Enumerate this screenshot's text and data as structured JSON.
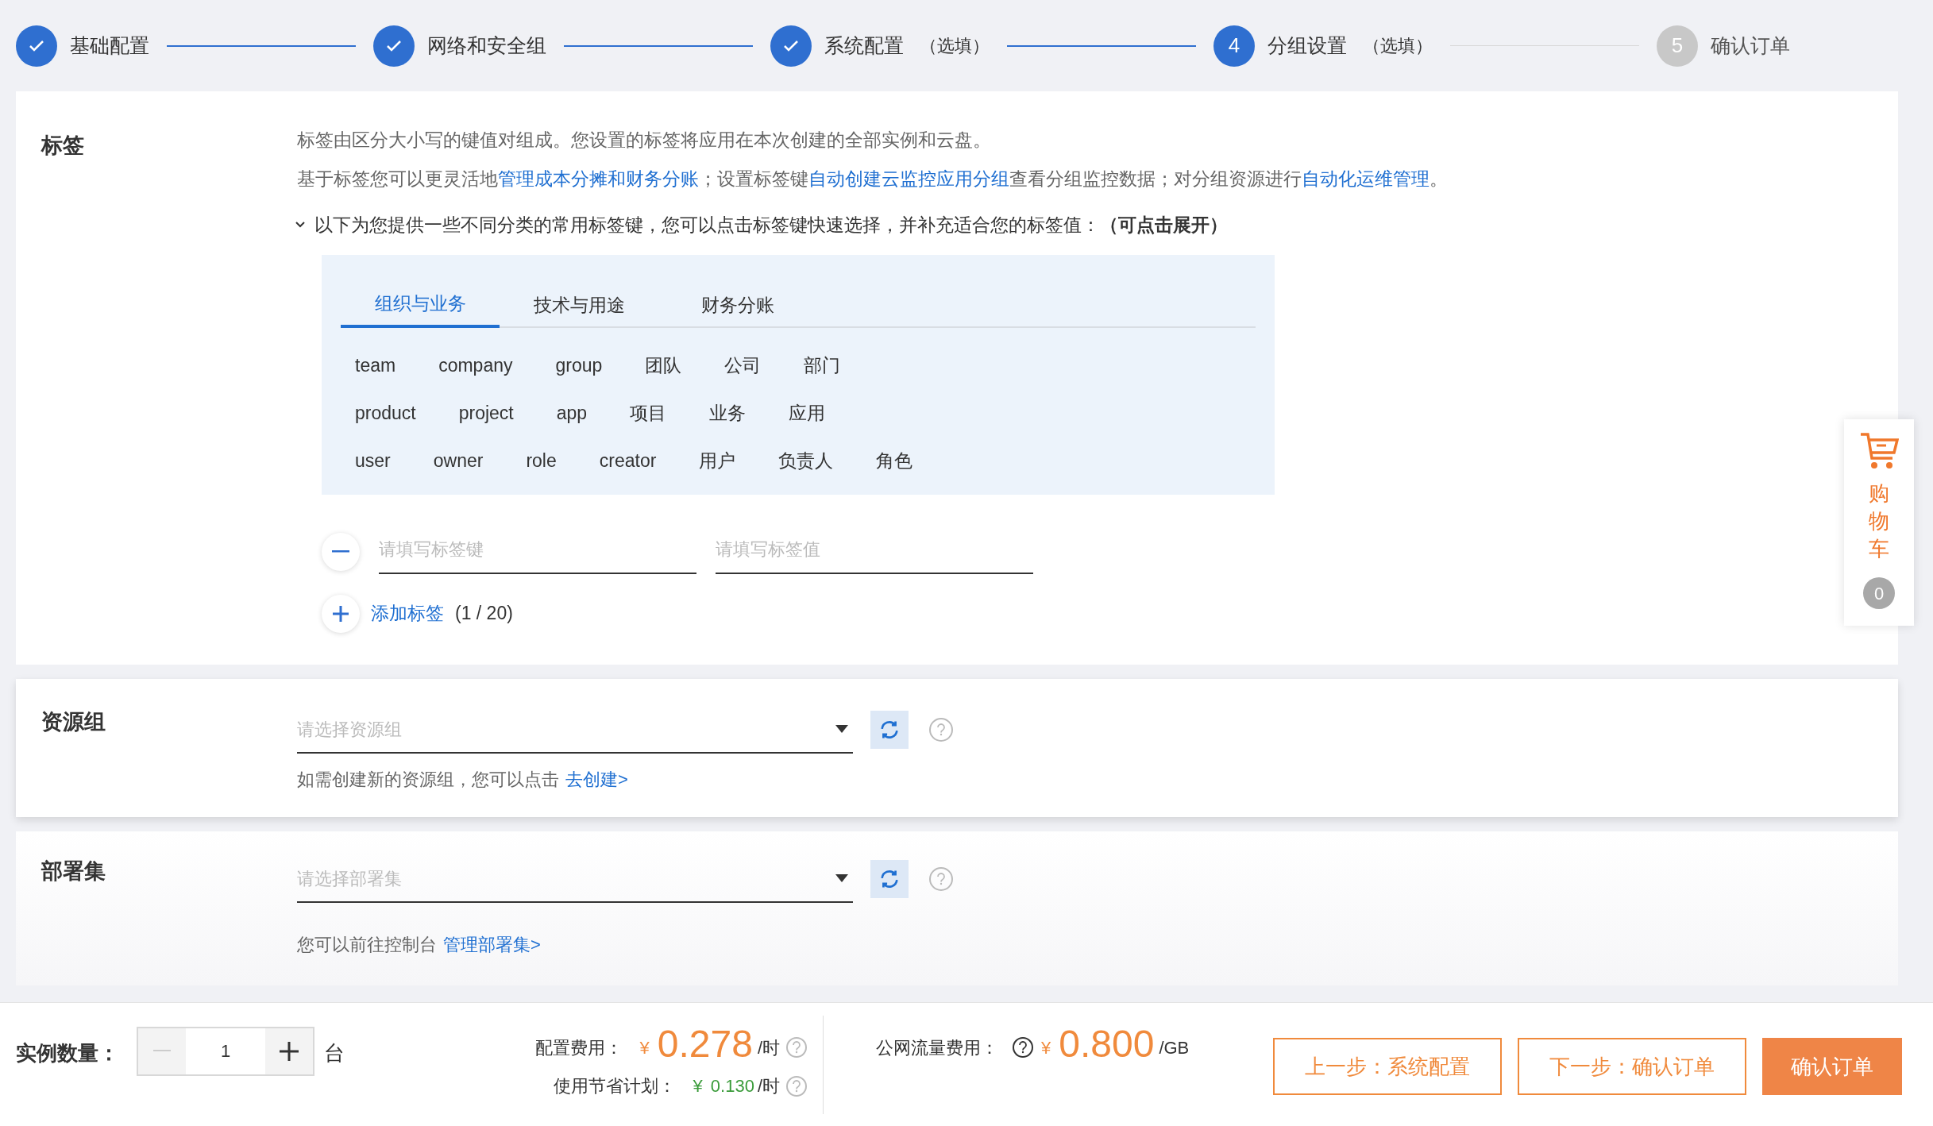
{
  "steps": [
    {
      "label": "基础配置",
      "completed": true,
      "selected": false
    },
    {
      "label": "网络和安全组",
      "completed": true,
      "selected": false
    },
    {
      "label": "系统配置",
      "note": "（选填）",
      "completed": true,
      "selected": false
    },
    {
      "number": "4",
      "label": "分组设置",
      "note": "（选填）",
      "completed": false,
      "selected": true
    },
    {
      "number": "5",
      "label": "确认订单",
      "completed": false,
      "selected": false
    }
  ],
  "tags_section": {
    "title": "标签",
    "intro": "标签由区分大小写的键值对组成。您设置的标签将应用在本次创建的全部实例和云盘。",
    "guide": [
      {
        "text": "基于标签您可以更灵活地",
        "link": false
      },
      {
        "text": "管理成本分摊和财务分账",
        "link": true
      },
      {
        "text": "；设置标签键",
        "link": false
      },
      {
        "text": "自动创建云监控应用分组",
        "link": true
      },
      {
        "text": "查看分组监控数据；对分组资源进行",
        "link": false
      },
      {
        "text": "自动化运维管理",
        "link": true
      },
      {
        "text": "。",
        "link": false
      }
    ],
    "hint": {
      "expanded": true,
      "text": "以下为您提供一些不同分类的常用标签键，您可以点击标签键快速选择，并补充适合您的标签值：**（可点击展开）**"
    },
    "tabs": [
      {
        "label": "组织与业务",
        "selected": true
      },
      {
        "label": "技术与用途",
        "selected": false
      },
      {
        "label": "财务分账",
        "selected": false
      }
    ],
    "keys": [
      [
        "team",
        "company",
        "group",
        "团队",
        "公司",
        "部门"
      ],
      [
        "product",
        "project",
        "app",
        "项目",
        "业务",
        "应用"
      ],
      [
        "user",
        "owner",
        "role",
        "creator",
        "用户",
        "负责人",
        "角色"
      ]
    ],
    "tag_row": {
      "key_placeholder": "请填写标签键",
      "value_placeholder": "请填写标签值"
    },
    "add_tag": {
      "label": "添加标签",
      "count": "(1 / 20)"
    }
  },
  "resource_group": {
    "title": "资源组",
    "placeholder": "请选择资源组",
    "help": "如需创建新的资源组，您可以点击",
    "link": "去创建>"
  },
  "deployment_set": {
    "title": "部署集",
    "placeholder": "请选择部署集",
    "help": "您可以前往控制台",
    "link": "管理部署集>"
  },
  "footer": {
    "quantity_label": "实例数量：",
    "quantity": "1",
    "minus_disabled": true,
    "unit": "台",
    "config_fee_label": "配置费用：",
    "config_currency": "¥",
    "config_fee": "0.278",
    "config_unit": "/时",
    "savings_label": "使用节省计划：",
    "savings_currency": "¥",
    "savings_fee": "0.130",
    "savings_unit": "/时",
    "traffic_label": "公网流量费用：",
    "traffic_currency": "¥",
    "traffic_fee": "0.800",
    "traffic_unit": "/GB",
    "buttons": [
      {
        "label": "上一步：系统配置",
        "kind": "outline"
      },
      {
        "label": "下一步：确认订单",
        "kind": "outline"
      },
      {
        "label": "确认订单",
        "kind": "primary"
      }
    ]
  },
  "cart": {
    "label": "购物车",
    "count": "0"
  }
}
